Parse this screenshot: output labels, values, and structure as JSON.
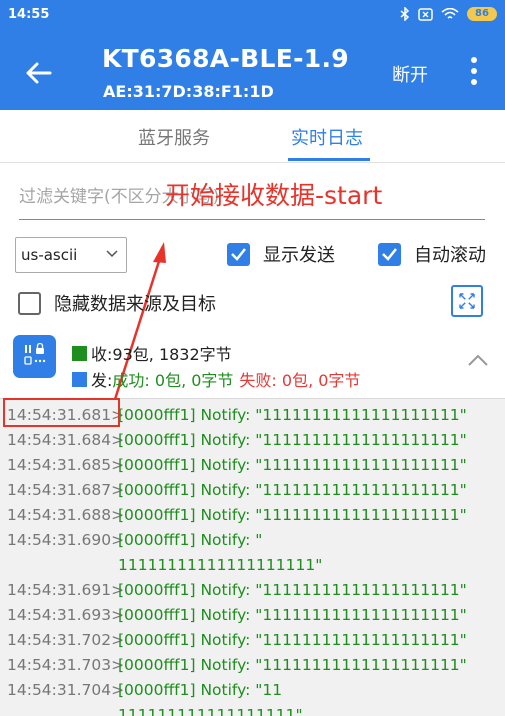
{
  "status_bar": {
    "time": "14:55",
    "battery": "86",
    "icons": [
      "bluetooth-icon",
      "notification-icon",
      "wifi-icon",
      "battery-icon"
    ]
  },
  "app_bar": {
    "title": "KT6368A-BLE-1.9",
    "subtitle": "AE:31:7D:38:F1:1D",
    "disconnect_label": "断开",
    "icons": [
      "back-arrow-icon",
      "more-vert-icon"
    ]
  },
  "tabs": [
    {
      "label": "蓝牙服务",
      "active": false
    },
    {
      "label": "实时日志",
      "active": true
    }
  ],
  "filter": {
    "placeholder": "过滤关键字(不区分大小写)",
    "value": ""
  },
  "annotation": {
    "text": "开始接收数据-start",
    "color": "#e8332a"
  },
  "controls": {
    "encoding": "us-ascii",
    "show_send_label": "显示发送",
    "show_send_checked": true,
    "auto_scroll_label": "自动滚动",
    "auto_scroll_checked": true,
    "hide_source_label": "隐藏数据来源及目标",
    "hide_source_checked": false
  },
  "stats": {
    "recv_prefix": "收: ",
    "recv_text": "93包, 1832字节",
    "send_prefix": "发: ",
    "send_success": "成功: 0包, 0字节",
    "send_fail": "失败: 0包, 0字节"
  },
  "log": [
    {
      "time": "14:54:31.681>",
      "lines": [
        "[0000fff1] Notify: \"11111111111111111111\""
      ]
    },
    {
      "time": "14:54:31.684>",
      "lines": [
        "[0000fff1] Notify: \"11111111111111111111\""
      ]
    },
    {
      "time": "14:54:31.685>",
      "lines": [
        "[0000fff1] Notify: \"11111111111111111111\""
      ]
    },
    {
      "time": "14:54:31.687>",
      "lines": [
        "[0000fff1] Notify: \"11111111111111111111\""
      ]
    },
    {
      "time": "14:54:31.688>",
      "lines": [
        "[0000fff1] Notify: \"11111111111111111111\""
      ]
    },
    {
      "time": "14:54:31.690>",
      "lines": [
        "[0000fff1] Notify: \"",
        "11111111111111111111\""
      ]
    },
    {
      "time": "14:54:31.691>",
      "lines": [
        "[0000fff1] Notify: \"11111111111111111111\""
      ]
    },
    {
      "time": "14:54:31.693>",
      "lines": [
        "[0000fff1] Notify: \"11111111111111111111\""
      ]
    },
    {
      "time": "14:54:31.702>",
      "lines": [
        "[0000fff1] Notify: \"11111111111111111111\""
      ]
    },
    {
      "time": "14:54:31.703>",
      "lines": [
        "[0000fff1] Notify: \"11111111111111111111\""
      ]
    },
    {
      "time": "14:54:31.704>",
      "lines": [
        "[0000fff1] Notify: \"11",
        "111111111111111111\""
      ]
    }
  ],
  "colors": {
    "primary": "#2f7fe6",
    "received": "#1e8e1e",
    "error": "#e53935",
    "annotation": "#e8332a"
  }
}
